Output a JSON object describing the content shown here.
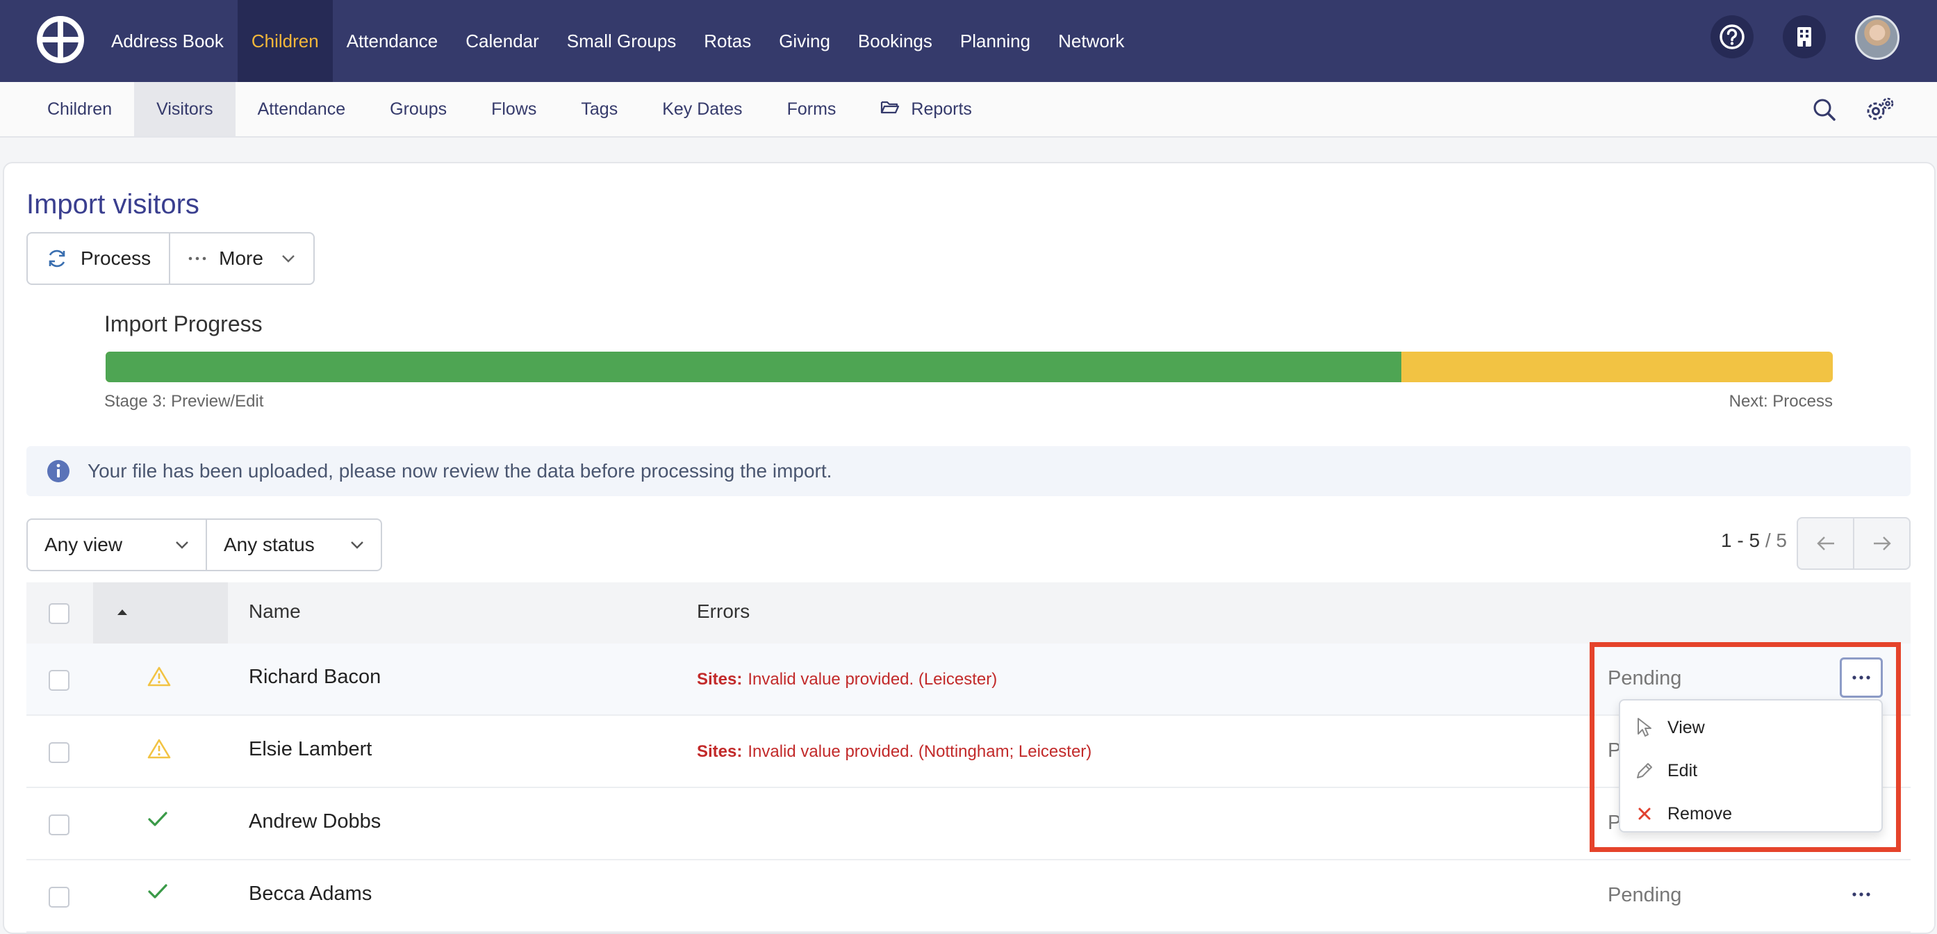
{
  "topnav": {
    "items": [
      "Address Book",
      "Children",
      "Attendance",
      "Calendar",
      "Small Groups",
      "Rotas",
      "Giving",
      "Bookings",
      "Planning",
      "Network"
    ],
    "active_index": 1
  },
  "subnav": {
    "items": [
      "Children",
      "Visitors",
      "Attendance",
      "Groups",
      "Flows",
      "Tags",
      "Key Dates",
      "Forms",
      "Reports"
    ],
    "active_index": 1
  },
  "page": {
    "title": "Import visitors",
    "actions": {
      "process": "Process",
      "more": "More"
    }
  },
  "progress": {
    "label": "Import Progress",
    "value": 0.75,
    "stage": "Stage 3: Preview/Edit",
    "next": "Next: Process",
    "colors": {
      "done": "#4ea553",
      "remaining": "#f2c343"
    }
  },
  "info": {
    "text": "Your file has been uploaded, please now review the data before processing the import."
  },
  "filters": {
    "view": "Any view",
    "status": "Any status"
  },
  "pager": {
    "range": "1 - 5",
    "total": "5"
  },
  "table": {
    "columns": {
      "name": "Name",
      "errors": "Errors"
    },
    "rows": [
      {
        "name": "Richard Bacon",
        "icon": "warning-icon",
        "error_label": "Sites:",
        "error_text": "Invalid value provided. (Leicester)",
        "status": "Pending"
      },
      {
        "name": "Elsie Lambert",
        "icon": "warning-icon",
        "error_label": "Sites:",
        "error_text": "Invalid value provided. (Nottingham; Leicester)",
        "status": "P"
      },
      {
        "name": "Andrew Dobbs",
        "icon": "check-icon",
        "error_label": "",
        "error_text": "",
        "status": "P"
      },
      {
        "name": "Becca Adams",
        "icon": "check-icon",
        "error_label": "",
        "error_text": "",
        "status": "Pending"
      }
    ]
  },
  "row_menu": {
    "items": [
      "View",
      "Edit",
      "Remove"
    ]
  },
  "colors": {
    "brand": "#353a6b",
    "accent": "#f3b73a",
    "error": "#c22a2a",
    "annotation": "#e5432b"
  }
}
